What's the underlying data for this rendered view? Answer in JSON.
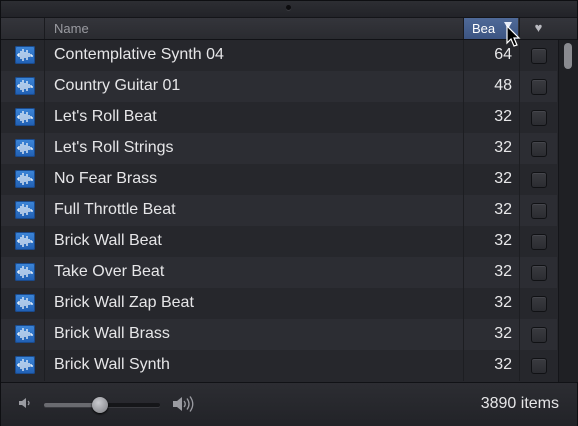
{
  "header": {
    "name_label": "Name",
    "beats_label": "Bea",
    "favorite_symbol": "♥"
  },
  "rows": [
    {
      "name": "Contemplative Synth 04",
      "beats": "64"
    },
    {
      "name": "Country Guitar 01",
      "beats": "48"
    },
    {
      "name": "Let's Roll Beat",
      "beats": "32"
    },
    {
      "name": "Let's Roll Strings",
      "beats": "32"
    },
    {
      "name": "No Fear Brass",
      "beats": "32"
    },
    {
      "name": "Full Throttle Beat",
      "beats": "32"
    },
    {
      "name": "Brick Wall Beat",
      "beats": "32"
    },
    {
      "name": "Take Over Beat",
      "beats": "32"
    },
    {
      "name": "Brick Wall Zap Beat",
      "beats": "32"
    },
    {
      "name": "Brick Wall Brass",
      "beats": "32"
    },
    {
      "name": "Brick Wall Synth",
      "beats": "32"
    }
  ],
  "row_icon": "audio-waveform-icon",
  "footer": {
    "item_count": "3890 items",
    "volume_fraction": 0.48
  },
  "colors": {
    "sorted_column_header": "#4a6494",
    "waveform_icon": "#2f74c8"
  }
}
